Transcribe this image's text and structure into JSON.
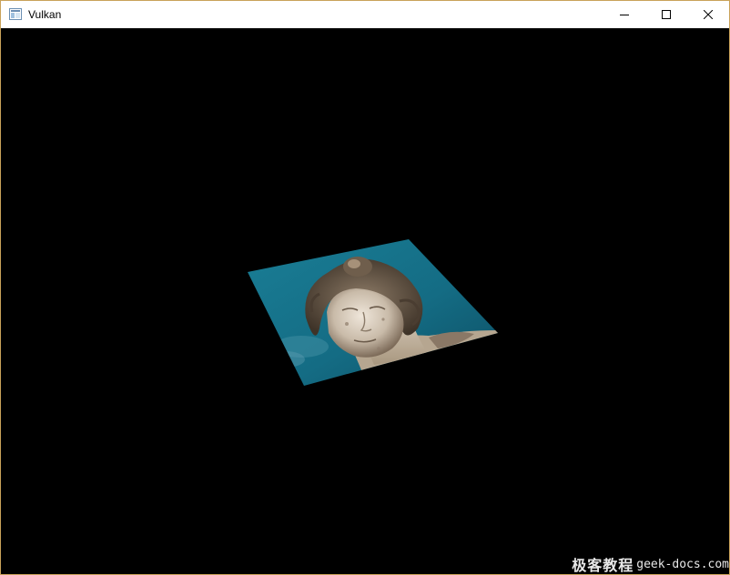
{
  "window": {
    "title": "Vulkan",
    "app_icon": "window-app-icon",
    "background": "#000000"
  },
  "caption_buttons": {
    "minimize_icon": "minimize-icon",
    "maximize_icon": "maximize-icon",
    "close_icon": "close-icon"
  },
  "scene": {
    "description_icon": "textured-quad",
    "colors": {
      "sky_teal": "#1f7e95",
      "sky_dark": "#0d4e63",
      "statue_light": "#d9cfc2",
      "statue_shadow": "#6a5a4a"
    }
  },
  "watermark": {
    "logo_text": "极客教程",
    "url": "geek-docs.com"
  }
}
